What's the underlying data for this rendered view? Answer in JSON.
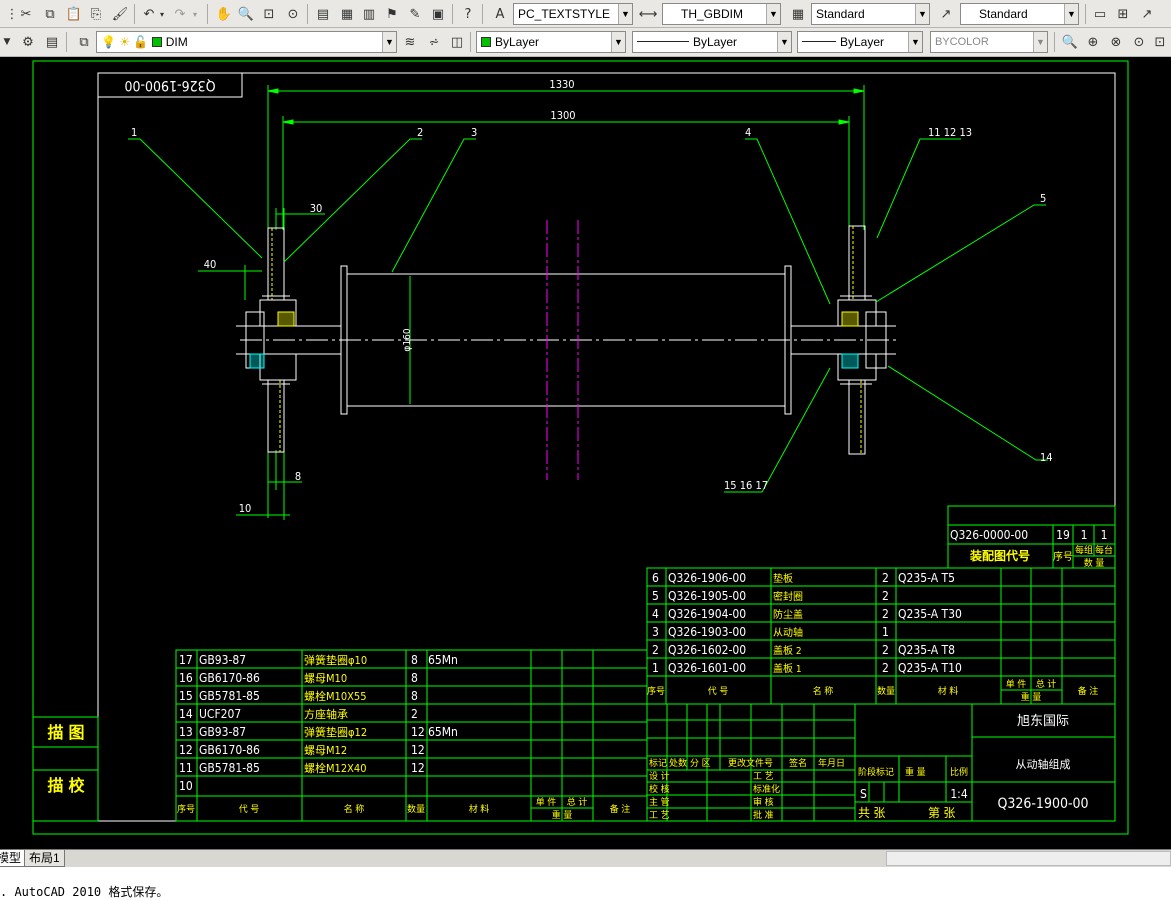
{
  "toolbar1": {
    "text_style": "PC_TEXTSTYLE",
    "dim_style": "TH_GBDIM",
    "table_style": "Standard",
    "multileader_style": "Standard"
  },
  "toolbar2": {
    "layer": "DIM",
    "color": "ByLayer",
    "linetype": "ByLayer",
    "lineweight": "ByLayer",
    "plotstyle": "BYCOLOR"
  },
  "drawing": {
    "title_code_box": "Q326-1900-00",
    "dims": {
      "d1330": "1330",
      "d1300": "1300",
      "d30": "30",
      "d40": "40",
      "d8": "8",
      "d10": "10",
      "dia": "φ160"
    },
    "balloons": {
      "b1": "1",
      "b2": "2",
      "b3": "3",
      "b4": "4",
      "b5": "5",
      "b11": "11 12 13",
      "b14": "14",
      "b15": "15 16 17"
    },
    "assembly": {
      "code": "Q326-0000-00",
      "seq": "19",
      "qty1": "1",
      "qty2": "1",
      "label": "装配图代号",
      "h1": "序号",
      "h2": "每组",
      "h3": "每台",
      "h4": "数  量"
    },
    "bom_right": [
      {
        "no": "6",
        "code": "Q326-1906-00",
        "name": "垫板",
        "qty": "2",
        "mat": "Q235-A T5"
      },
      {
        "no": "5",
        "code": "Q326-1905-00",
        "name": "密封圈",
        "qty": "2",
        "mat": ""
      },
      {
        "no": "4",
        "code": "Q326-1904-00",
        "name": "防尘盖",
        "qty": "2",
        "mat": "Q235-A T30"
      },
      {
        "no": "3",
        "code": "Q326-1903-00",
        "name": "从动轴",
        "qty": "1",
        "mat": ""
      },
      {
        "no": "2",
        "code": "Q326-1602-00",
        "name": "盖板 2",
        "qty": "2",
        "mat": "Q235-A T8"
      },
      {
        "no": "1",
        "code": "Q326-1601-00",
        "name": "盖板 1",
        "qty": "2",
        "mat": "Q235-A T10"
      }
    ],
    "bom_right_header": {
      "no": "序号",
      "code": "代  号",
      "name": "名    称",
      "qty": "数量",
      "mat": "材    料",
      "w1": "单 件",
      "w2": "总 计",
      "w3": "重 量",
      "note": "备 注"
    },
    "bom_left": [
      {
        "no": "17",
        "code": "GB93-87",
        "name": "弹簧垫圈φ10",
        "qty": "8",
        "mat": "65Mn"
      },
      {
        "no": "16",
        "code": "GB6170-86",
        "name": "螺母M10",
        "qty": "8",
        "mat": ""
      },
      {
        "no": "15",
        "code": "GB5781-85",
        "name": "螺栓M10X55",
        "qty": "8",
        "mat": ""
      },
      {
        "no": "14",
        "code": "UCF207",
        "name": "方座轴承",
        "qty": "2",
        "mat": ""
      },
      {
        "no": "13",
        "code": "GB93-87",
        "name": "弹簧垫圈φ12",
        "qty": "12",
        "mat": "65Mn"
      },
      {
        "no": "12",
        "code": "GB6170-86",
        "name": "螺母M12",
        "qty": "12",
        "mat": ""
      },
      {
        "no": "11",
        "code": "GB5781-85",
        "name": "螺栓M12X40",
        "qty": "12",
        "mat": ""
      },
      {
        "no": "10",
        "code": "",
        "name": "",
        "qty": "",
        "mat": ""
      }
    ],
    "bom_left_header": {
      "no": "序号",
      "code": "代  号",
      "name": "名    称",
      "qty": "数量",
      "mat": "材    料",
      "w1": "单 件",
      "w2": "总 计",
      "w3": "重 量",
      "note": "备 注"
    },
    "side_labels": {
      "draw": "描  图",
      "check": "描  校"
    },
    "title_block": {
      "company": "旭东国际",
      "name": "从动轴组成",
      "code": "Q326-1900-00",
      "scale": "1:4",
      "stage_s": "S",
      "h_stage": "阶段标记",
      "h_weight": "重  量",
      "h_scale": "比例",
      "total": "共    张",
      "sheet": "第    张",
      "rev": [
        "标记",
        "处数",
        "分 区",
        "更改文件号",
        "签名",
        "年月日"
      ],
      "roles_l": [
        "设 计",
        "校 核",
        "主 管",
        "工 艺"
      ],
      "roles_r": [
        "工 艺",
        "标准化",
        "审 核",
        "批 准"
      ]
    }
  },
  "tabs": {
    "model": "模型",
    "layout1": "布局1"
  },
  "command_line": ". AutoCAD 2010 格式保存。"
}
